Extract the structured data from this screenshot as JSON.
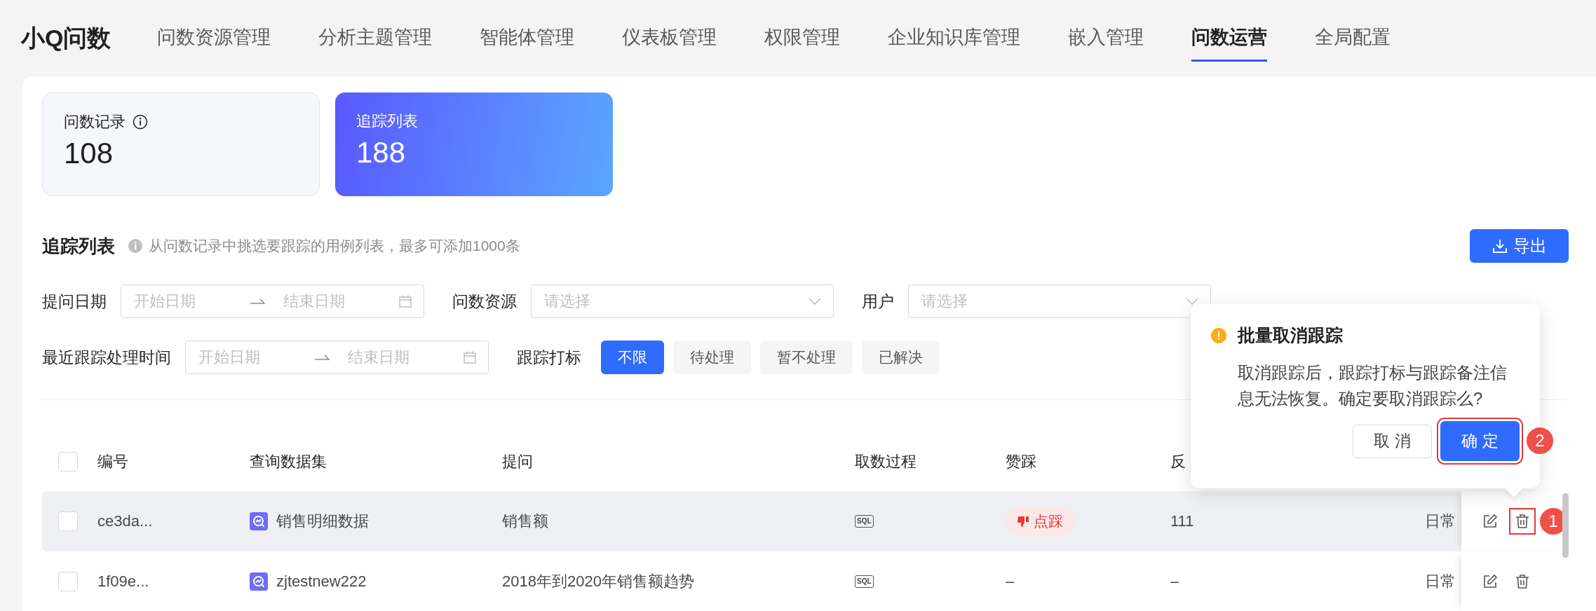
{
  "app": {
    "logo": "小Q问数"
  },
  "nav": [
    {
      "label": "问数资源管理",
      "selected": false
    },
    {
      "label": "分析主题管理",
      "selected": false
    },
    {
      "label": "智能体管理",
      "selected": false
    },
    {
      "label": "仪表板管理",
      "selected": false
    },
    {
      "label": "权限管理",
      "selected": false
    },
    {
      "label": "企业知识库管理",
      "selected": false
    },
    {
      "label": "嵌入管理",
      "selected": false
    },
    {
      "label": "问数运营",
      "selected": true
    },
    {
      "label": "全局配置",
      "selected": false
    }
  ],
  "stat_cards": [
    {
      "label": "问数记录",
      "value": "108",
      "info": true,
      "selected": false
    },
    {
      "label": "追踪列表",
      "value": "188",
      "info": false,
      "selected": true
    }
  ],
  "section": {
    "title": "追踪列表",
    "hint": "从问数记录中挑选要跟踪的用例列表，最多可添加1000条",
    "export_button": "导出"
  },
  "filter_rows": [
    [
      {
        "kind": "date_range",
        "label": "提问日期",
        "start_placeholder": "开始日期",
        "end_placeholder": "结束日期"
      },
      {
        "kind": "select",
        "label": "问数资源",
        "placeholder": "请选择"
      },
      {
        "kind": "select",
        "label": "用户",
        "placeholder": "请选择"
      }
    ],
    [
      {
        "kind": "date_range",
        "label": "最近跟踪处理时间",
        "start_placeholder": "开始日期",
        "end_placeholder": "结束日期"
      },
      {
        "kind": "chips",
        "label": "跟踪打标",
        "options": [
          {
            "label": "不限",
            "selected": true
          },
          {
            "label": "待处理",
            "selected": false
          },
          {
            "label": "暂不处理",
            "selected": false
          },
          {
            "label": "已解决",
            "selected": false
          }
        ]
      }
    ]
  ],
  "table": {
    "header_checked": false,
    "columns": [
      "编号",
      "查询数据集",
      "提问",
      "取数过程",
      "赞踩",
      "反"
    ],
    "rows": [
      {
        "checked": false,
        "highlighted": true,
        "id": "ce3da...",
        "dataset": "销售明细数据",
        "question": "销售额",
        "process": "SQL",
        "vote": {
          "kind": "dislike",
          "label": "点踩"
        },
        "feedback": "111",
        "column_8": "日常",
        "delete_callout": "1"
      },
      {
        "checked": false,
        "highlighted": false,
        "id": "1f09e...",
        "dataset": "zjtestnew222",
        "question": "2018年到2020年销售额趋势",
        "process": "SQL",
        "vote": {
          "kind": "text",
          "label": "–"
        },
        "feedback": "–",
        "column_8": "日常"
      }
    ]
  },
  "popover": {
    "title": "批量取消跟踪",
    "message": "取消跟踪后，跟踪打标与跟踪备注信息无法恢复。确定要取消跟踪么?",
    "cancel": "取 消",
    "confirm": "确 定",
    "confirm_callout": "2"
  }
}
